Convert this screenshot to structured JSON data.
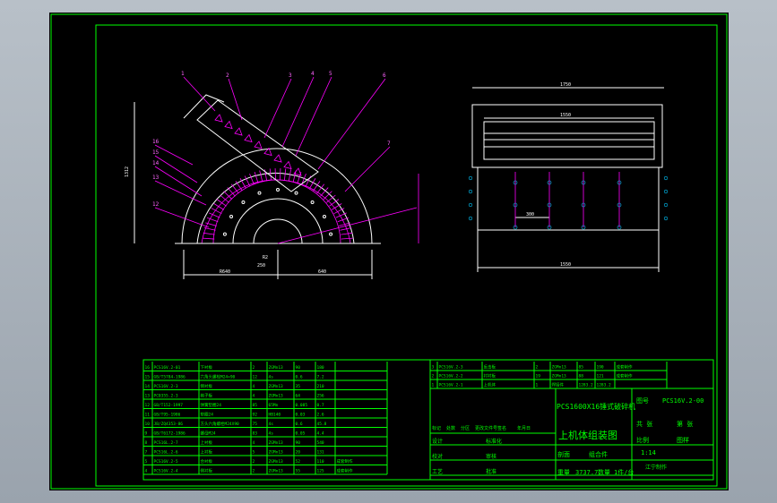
{
  "drawing": {
    "title_cn": "PCS1600X16锤式破碎机",
    "subtitle": "上机体组装图",
    "drawing_no_label": "图号",
    "drawing_no": "PCS16V.2-00",
    "sheet_total_label": "共 张",
    "sheet_no_label": "第 张",
    "scale_label": "比例",
    "scale": "1:14",
    "material_label": "图样",
    "weight_label": "重量",
    "weight": "3737.7",
    "qty_label": "数量",
    "qty": "1件/台",
    "company": "江宁制作",
    "header_row": [
      "标记",
      "处数",
      "分区",
      "更改文件号",
      "签名",
      "年月日"
    ],
    "role_labels": [
      "设计",
      "标准化",
      "校对",
      "审核",
      "工艺",
      "批准"
    ],
    "assembly_label": "组合件",
    "section_label": "剖面"
  },
  "bom_left": [
    [
      "16",
      "PCS16V.2-01",
      "下衬板",
      "2",
      "ZGMn13",
      "90",
      "180",
      ""
    ],
    [
      "15",
      "GB/T5784-1986",
      "六角头螺栓M24×90",
      "12",
      "4s",
      "0.6",
      "7.2",
      ""
    ],
    [
      "14",
      "PCS16V.2-3",
      "侧衬板",
      "4",
      "ZGMn13",
      "35",
      "210",
      ""
    ],
    [
      "13",
      "PC0355.2-3",
      "格子板",
      "4",
      "ZGMn13",
      "64",
      "256",
      ""
    ],
    [
      "12",
      "GB/T152-1997",
      "弹簧垫圈24",
      "85",
      "65Mn",
      "0.085",
      "0.7",
      ""
    ],
    [
      "11",
      "GB/T95-1986",
      "垫圈24",
      "92",
      "HB140",
      "0.03",
      "2.6",
      ""
    ],
    [
      "10",
      "JB/ZQ4353-86",
      "方头六角螺栓M24X90",
      "75",
      "4s",
      "0.6",
      "45.8",
      ""
    ],
    [
      "9",
      "GB/T6172-1986",
      "螺母M24",
      "83",
      "4s",
      "0.05",
      "4.4",
      ""
    ],
    [
      "8",
      "PCS16L.2-7",
      "上衬板",
      "4",
      "ZGMn13",
      "90",
      "540",
      ""
    ],
    [
      "7",
      "PCS16L.2-6",
      "上衬板",
      "5",
      "ZGMn13",
      "20",
      "131",
      ""
    ],
    [
      "5",
      "PCS16V.2-5",
      "合衬板",
      "2",
      "ZGMn13",
      "52",
      "110",
      "成套制作"
    ],
    [
      "4",
      "PCS16V.2-4",
      "侧衬板",
      "2",
      "ZGMn13",
      "55",
      "125",
      "成套制作"
    ]
  ],
  "bom_right": [
    [
      "3",
      "PCS16V.2-3",
      "反击板",
      "2",
      "ZGMn13",
      "85",
      "190",
      "成套制作"
    ],
    [
      "2",
      "PCS16V.2-2",
      "衬衬板",
      "19",
      "ZGMn13",
      "88",
      "121",
      "成套制作"
    ],
    [
      "1",
      "PCS16V.2-1",
      "上机体",
      "1",
      "焊接件",
      "1283.2",
      "1283.2",
      ""
    ]
  ],
  "front_view": {
    "leaders": [
      "1",
      "2",
      "3",
      "4",
      "5",
      "6",
      "7",
      "16",
      "15",
      "14",
      "13",
      "12",
      "11",
      "10",
      "9",
      "8"
    ],
    "dims": [
      "R640",
      "1312",
      "640",
      "R2",
      "250",
      "R1"
    ]
  },
  "side_view": {
    "dims": [
      "1750",
      "1550",
      "1550",
      "300"
    ]
  }
}
